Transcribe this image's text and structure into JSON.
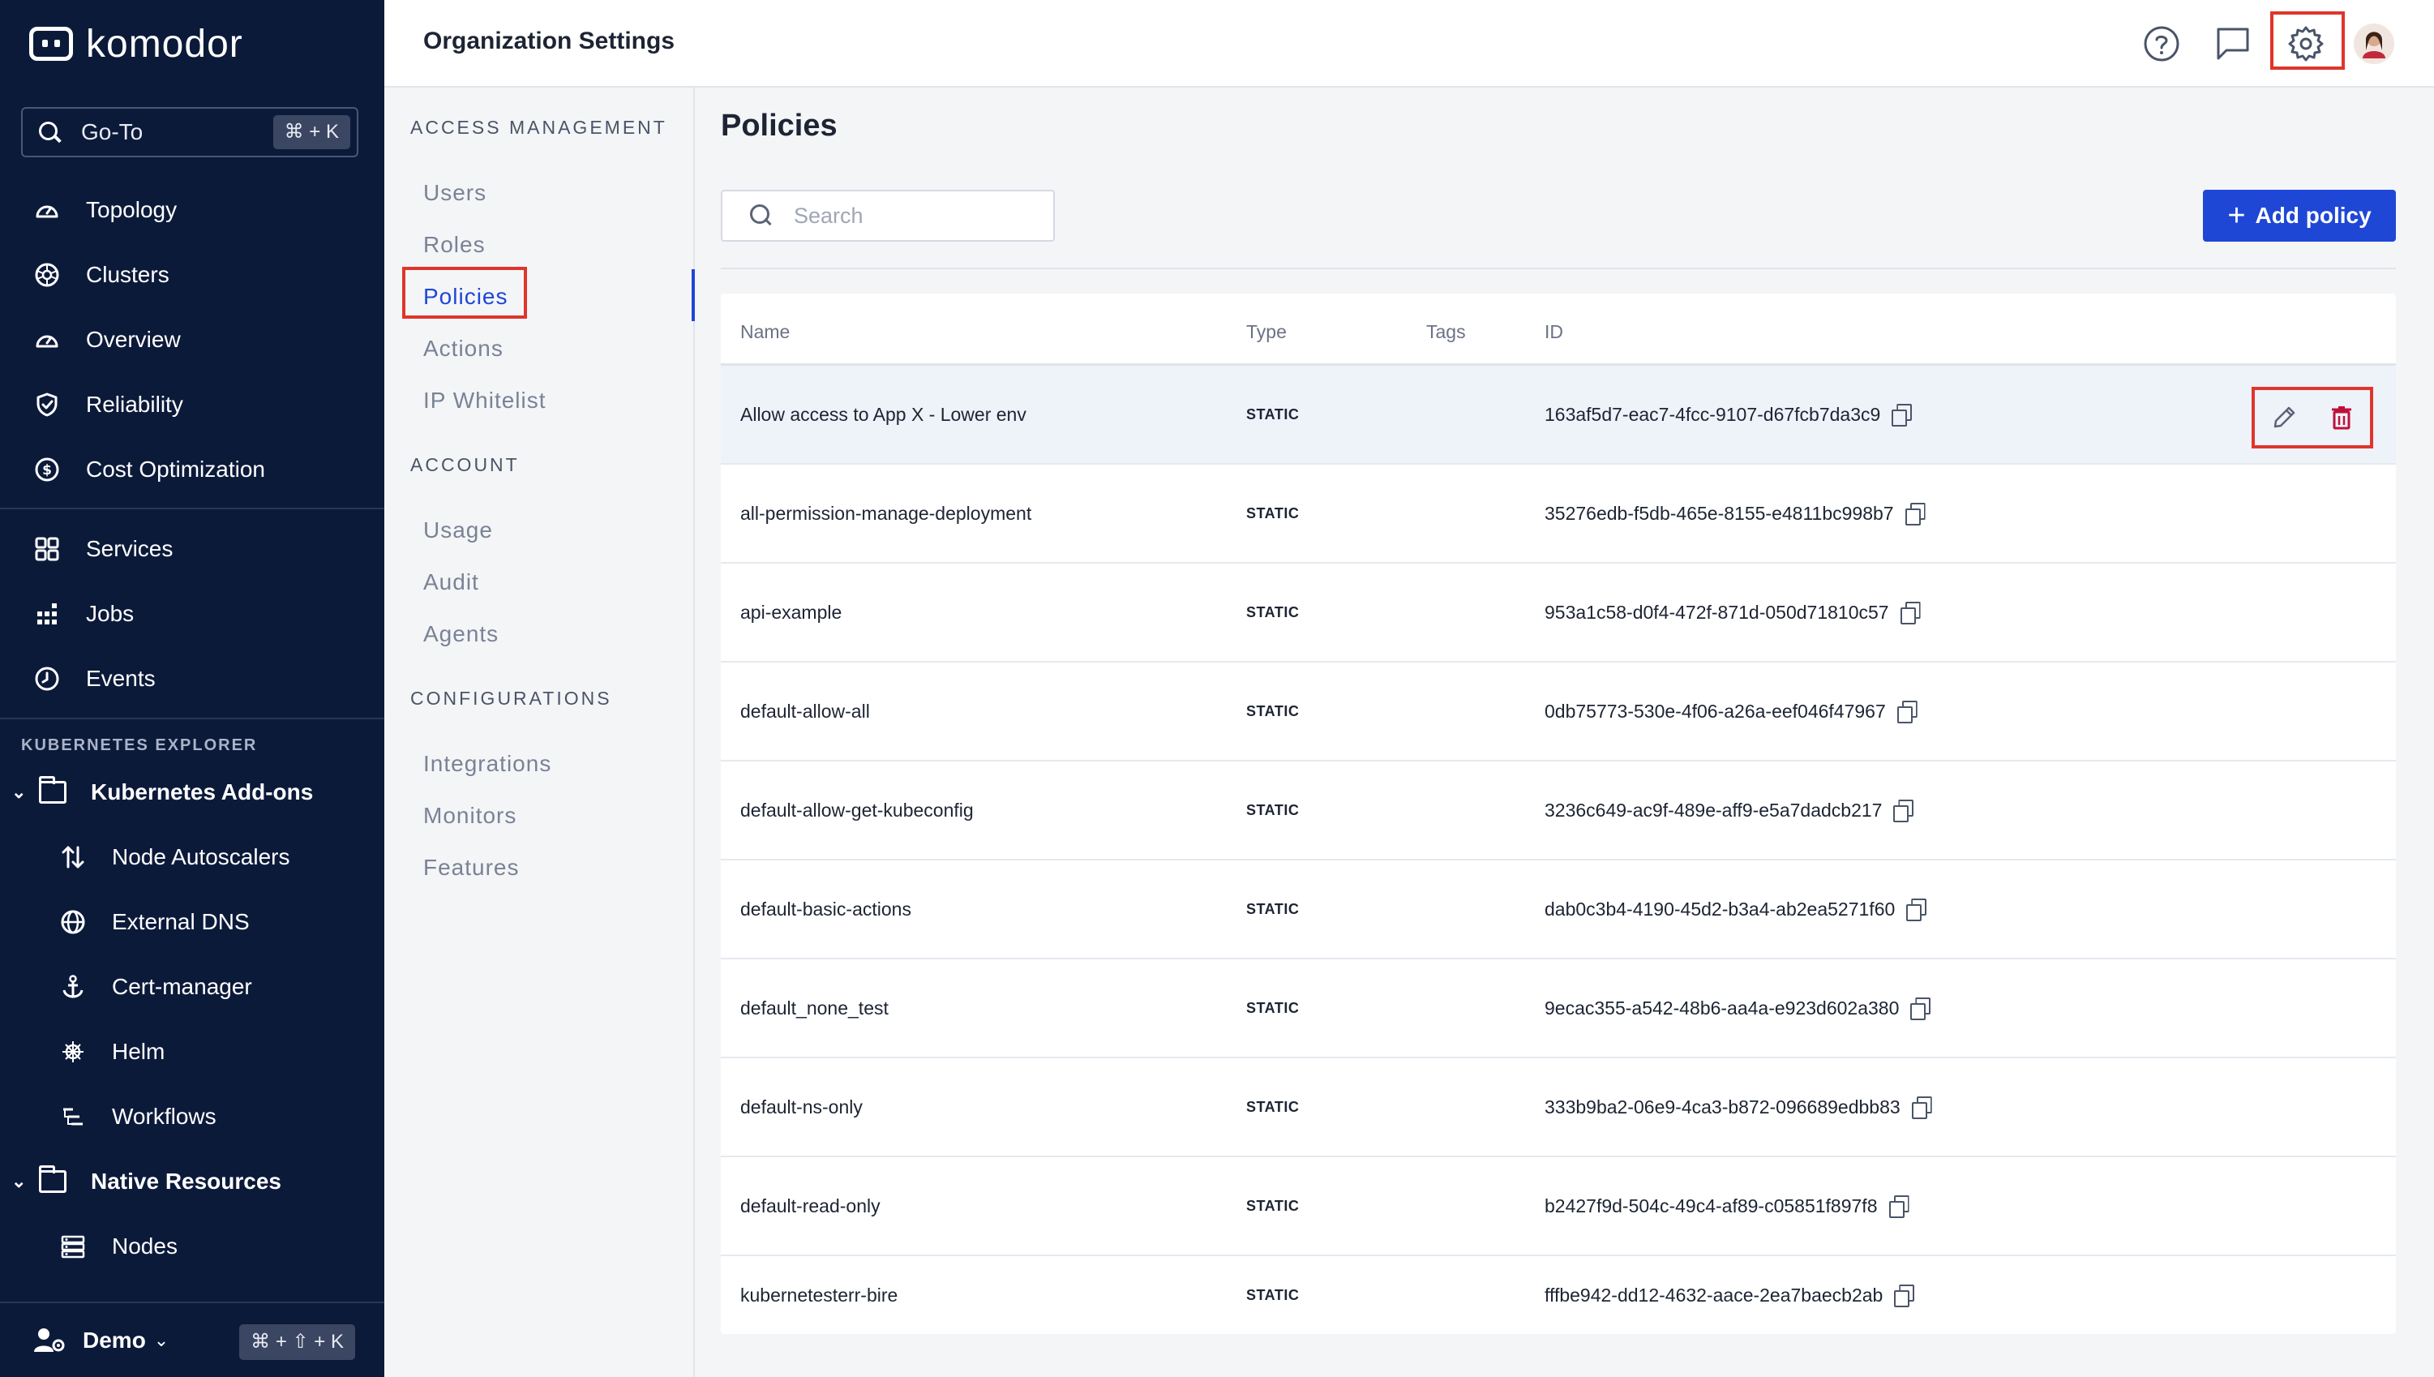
{
  "app": {
    "brand": "komodor"
  },
  "sidenav": {
    "goto": {
      "label": "Go-To",
      "shortcut": "⌘ + K"
    },
    "primary": [
      {
        "label": "Topology",
        "icon": "gauge-icon"
      },
      {
        "label": "Clusters",
        "icon": "cluster-icon"
      },
      {
        "label": "Overview",
        "icon": "gauge-icon"
      },
      {
        "label": "Reliability",
        "icon": "shield-check-icon"
      },
      {
        "label": "Cost Optimization",
        "icon": "dollar-icon"
      }
    ],
    "secondary": [
      {
        "label": "Services",
        "icon": "grid-icon"
      },
      {
        "label": "Jobs",
        "icon": "dots-grid-icon"
      },
      {
        "label": "Events",
        "icon": "clock-icon"
      }
    ],
    "explorer_section": "KUBERNETES EXPLORER",
    "groups": [
      {
        "label": "Kubernetes Add-ons",
        "items": [
          {
            "label": "Node Autoscalers",
            "icon": "arrows-updown-icon"
          },
          {
            "label": "External DNS",
            "icon": "globe-icon"
          },
          {
            "label": "Cert-manager",
            "icon": "anchor-icon"
          },
          {
            "label": "Helm",
            "icon": "helm-icon"
          },
          {
            "label": "Workflows",
            "icon": "workflow-icon"
          }
        ]
      },
      {
        "label": "Native Resources",
        "items": [
          {
            "label": "Nodes",
            "icon": "server-icon"
          }
        ]
      }
    ],
    "account": {
      "label": "Demo",
      "shortcut": "⌘ + ⇧ + K"
    }
  },
  "header": {
    "title": "Organization Settings"
  },
  "settings_nav": {
    "sections": [
      {
        "title": "ACCESS MANAGEMENT",
        "items": [
          "Users",
          "Roles",
          "Policies",
          "Actions",
          "IP Whitelist"
        ]
      },
      {
        "title": "ACCOUNT",
        "items": [
          "Usage",
          "Audit",
          "Agents"
        ]
      },
      {
        "title": "CONFIGURATIONS",
        "items": [
          "Integrations",
          "Monitors",
          "Features"
        ]
      }
    ],
    "active": "Policies"
  },
  "main": {
    "title": "Policies",
    "search": {
      "placeholder": "Search",
      "value": ""
    },
    "add_button": "Add policy",
    "table": {
      "columns": [
        "Name",
        "Type",
        "Tags",
        "ID"
      ],
      "rows": [
        {
          "name": "Allow access to App X - Lower env",
          "type": "STATIC",
          "tags": "",
          "id": "163af5d7-eac7-4fcc-9107-d67fcb7da3c9"
        },
        {
          "name": "all-permission-manage-deployment",
          "type": "STATIC",
          "tags": "",
          "id": "35276edb-f5db-465e-8155-e4811bc998b7"
        },
        {
          "name": "api-example",
          "type": "STATIC",
          "tags": "",
          "id": "953a1c58-d0f4-472f-871d-050d71810c57"
        },
        {
          "name": "default-allow-all",
          "type": "STATIC",
          "tags": "",
          "id": "0db75773-530e-4f06-a26a-eef046f47967"
        },
        {
          "name": "default-allow-get-kubeconfig",
          "type": "STATIC",
          "tags": "",
          "id": "3236c649-ac9f-489e-aff9-e5a7dadcb217"
        },
        {
          "name": "default-basic-actions",
          "type": "STATIC",
          "tags": "",
          "id": "dab0c3b4-4190-45d2-b3a4-ab2ea5271f60"
        },
        {
          "name": "default_none_test",
          "type": "STATIC",
          "tags": "",
          "id": "9ecac355-a542-48b6-aa4a-e923d602a380"
        },
        {
          "name": "default-ns-only",
          "type": "STATIC",
          "tags": "",
          "id": "333b9ba2-06e9-4ca3-b872-096689edbb83"
        },
        {
          "name": "default-read-only",
          "type": "STATIC",
          "tags": "",
          "id": "b2427f9d-504c-49c4-af89-c05851f897f8"
        },
        {
          "name": "kubernetesterr-bire",
          "type": "STATIC",
          "tags": "",
          "id": "fffbe942-dd12-4632-aace-2ea7baecb2ab"
        }
      ]
    }
  },
  "colors": {
    "nav_bg": "#0c1a3a",
    "accent": "#1f47d6",
    "highlight": "#e0352b",
    "danger": "#c0103a"
  }
}
